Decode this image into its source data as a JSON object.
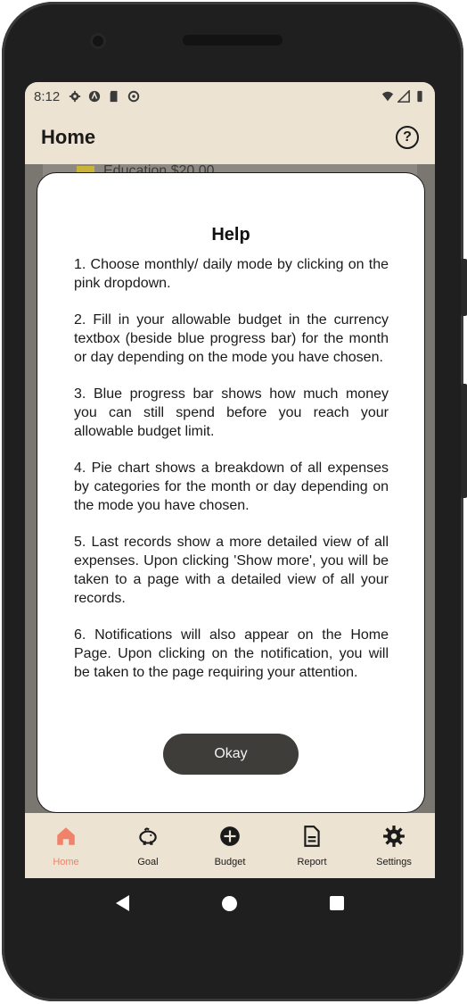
{
  "status_bar": {
    "time": "8:12",
    "left_icons": [
      "gear-icon",
      "vpn-icon",
      "sd-card-icon",
      "sync-icon"
    ],
    "right_icons": [
      "wifi-icon",
      "signal-icon",
      "battery-icon"
    ]
  },
  "app_bar": {
    "title": "Home",
    "help_icon_label": "?"
  },
  "background_peek": {
    "label": "Education $20.00",
    "swatch_color": "#c9b33c"
  },
  "help_dialog": {
    "title": "Help",
    "items": [
      "1. Choose monthly/ daily mode by clicking on the pink dropdown.",
      "2. Fill in your allowable budget in the currency textbox (beside blue progress bar) for the month or day depending on the mode you have chosen.",
      "3. Blue progress bar shows how much money you can still spend before you reach your allowable budget limit.",
      "4. Pie chart shows a breakdown of all expenses by categories for the month or day depending on the mode you have chosen.",
      "5. Last records show a more detailed view of all expenses. Upon clicking 'Show more', you will be taken to a page with a detailed view of all your records.",
      "6. Notifications will also appear on the Home Page. Upon clicking on the notification, you will be taken to the page requiring your attention."
    ],
    "okay_label": "Okay"
  },
  "bottom_nav": {
    "active": "Home",
    "items": [
      {
        "label": "Home",
        "icon": "home-icon"
      },
      {
        "label": "Goal",
        "icon": "piggy-bank-icon"
      },
      {
        "label": "Budget",
        "icon": "add-circle-icon"
      },
      {
        "label": "Report",
        "icon": "document-icon"
      },
      {
        "label": "Settings",
        "icon": "gear-icon"
      }
    ]
  },
  "colors": {
    "accent": "#f0826a",
    "surface": "#ece3d2",
    "button": "#3f3d3a"
  }
}
